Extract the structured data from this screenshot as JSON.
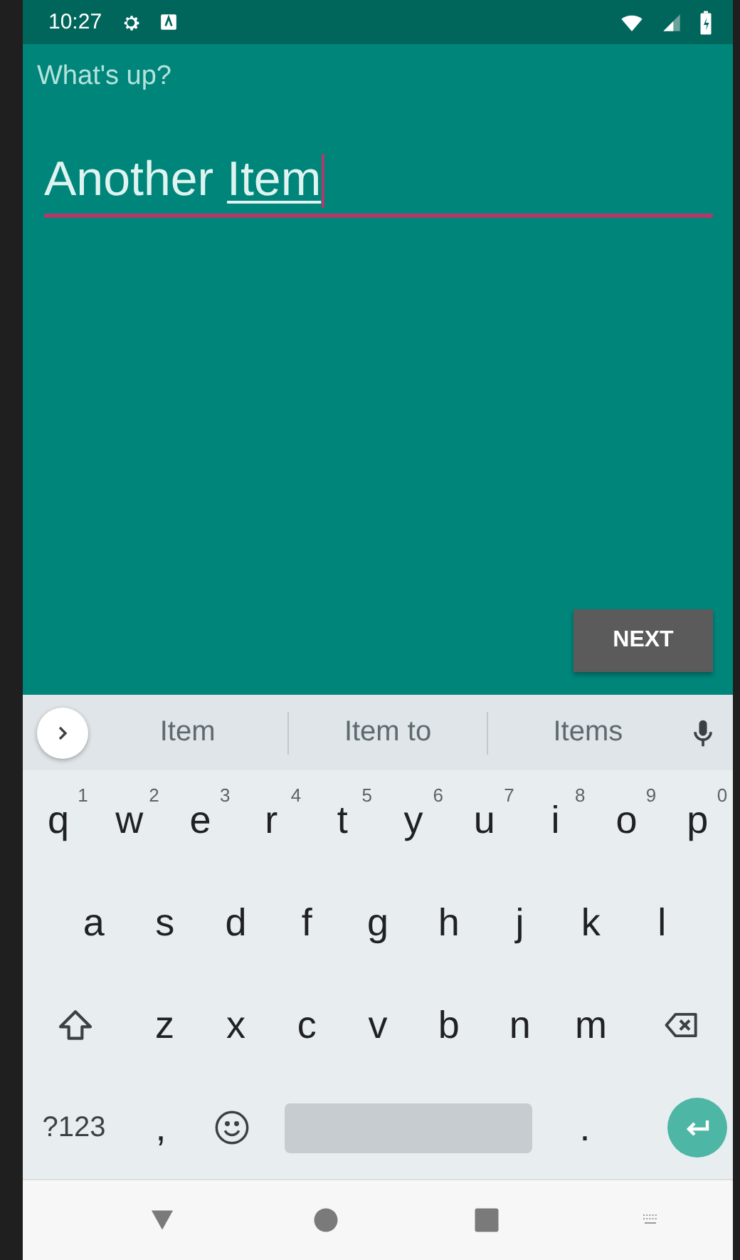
{
  "status_bar": {
    "time": "10:27"
  },
  "app": {
    "label": "What's up?",
    "field": {
      "value": "Another ",
      "composing": "Item",
      "focused": true
    },
    "button": "NEXT"
  },
  "suggestions": [
    "Item",
    "Item to",
    "Items"
  ],
  "keyboard": [
    [
      {
        "kind": "letter",
        "label": "q",
        "hint": "1"
      },
      {
        "kind": "letter",
        "label": "w",
        "hint": "2"
      },
      {
        "kind": "letter",
        "label": "e",
        "hint": "3"
      },
      {
        "kind": "letter",
        "label": "r",
        "hint": "4"
      },
      {
        "kind": "letter",
        "label": "t",
        "hint": "5"
      },
      {
        "kind": "letter",
        "label": "y",
        "hint": "6"
      },
      {
        "kind": "letter",
        "label": "u",
        "hint": "7"
      },
      {
        "kind": "letter",
        "label": "i",
        "hint": "8"
      },
      {
        "kind": "letter",
        "label": "o",
        "hint": "9"
      },
      {
        "kind": "letter",
        "label": "p",
        "hint": "0"
      }
    ],
    [
      {
        "kind": "letter",
        "label": "a"
      },
      {
        "kind": "letter",
        "label": "s"
      },
      {
        "kind": "letter",
        "label": "d"
      },
      {
        "kind": "letter",
        "label": "f"
      },
      {
        "kind": "letter",
        "label": "g"
      },
      {
        "kind": "letter",
        "label": "h"
      },
      {
        "kind": "letter",
        "label": "j"
      },
      {
        "kind": "letter",
        "label": "k"
      },
      {
        "kind": "letter",
        "label": "l"
      }
    ],
    [
      {
        "kind": "shift"
      },
      {
        "kind": "letter",
        "label": "z"
      },
      {
        "kind": "letter",
        "label": "x"
      },
      {
        "kind": "letter",
        "label": "c"
      },
      {
        "kind": "letter",
        "label": "v"
      },
      {
        "kind": "letter",
        "label": "b"
      },
      {
        "kind": "letter",
        "label": "n"
      },
      {
        "kind": "letter",
        "label": "m"
      },
      {
        "kind": "backspace"
      }
    ],
    [
      {
        "kind": "symbols",
        "label": "?123"
      },
      {
        "kind": "letter",
        "label": ","
      },
      {
        "kind": "emoji"
      },
      {
        "kind": "space"
      },
      {
        "kind": "letter",
        "label": "."
      },
      {
        "kind": "enter"
      }
    ]
  ]
}
